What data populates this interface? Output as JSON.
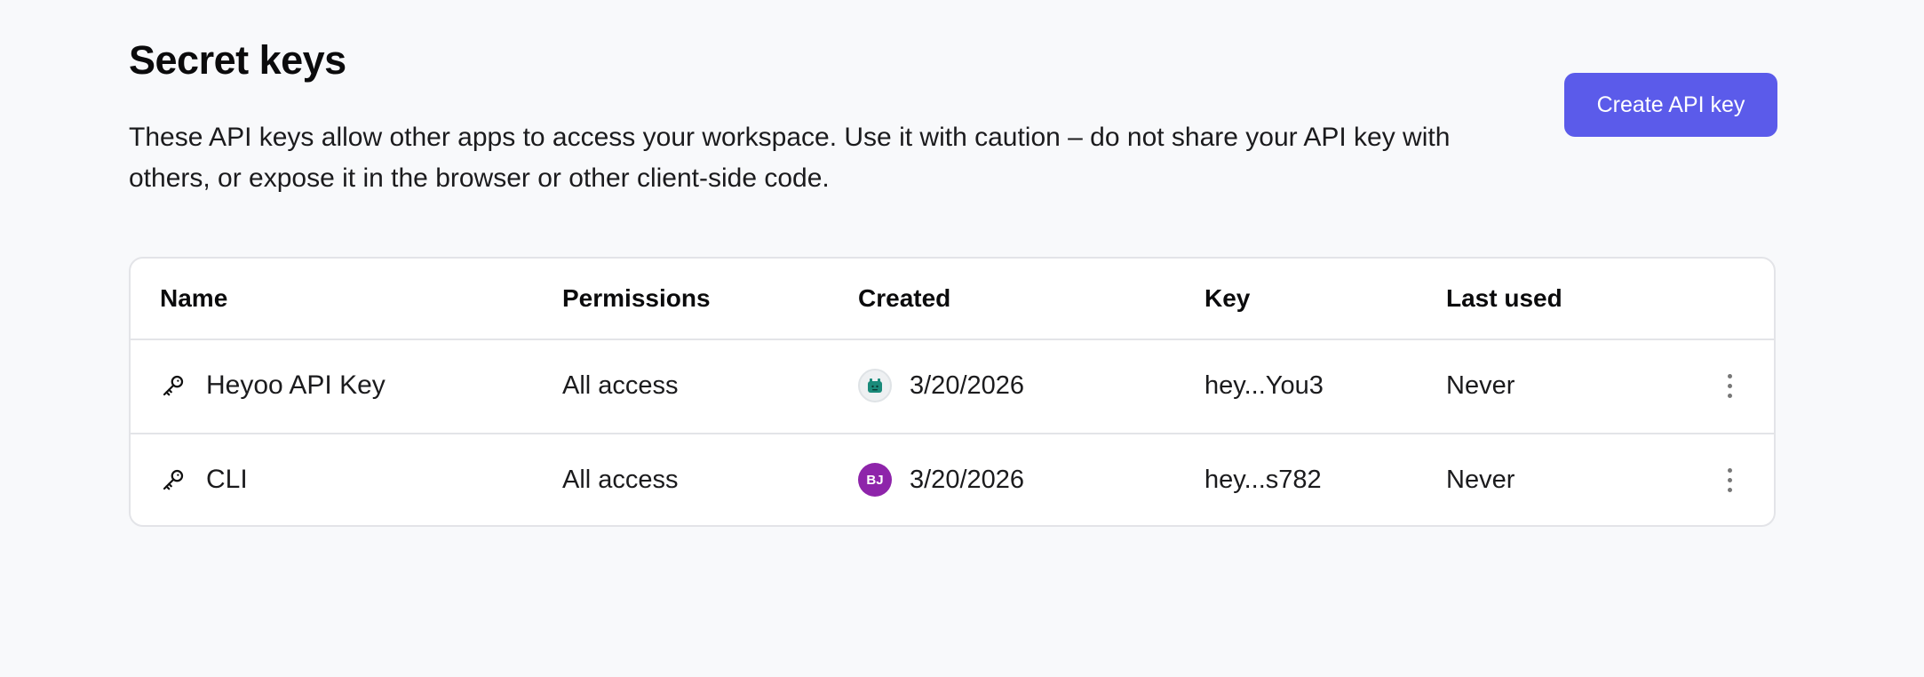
{
  "page": {
    "title": "Secret keys",
    "description": "These API keys allow other apps to access your workspace. Use it with caution – do not share your API key with others, or expose it in the browser or other client-side code.",
    "create_button_label": "Create API key"
  },
  "table": {
    "headers": {
      "name": "Name",
      "permissions": "Permissions",
      "created": "Created",
      "key": "Key",
      "last_used": "Last used"
    },
    "rows": [
      {
        "name": "Heyoo API Key",
        "permissions": "All access",
        "creator_avatar": "robot-avatar",
        "created": "3/20/2026",
        "key": "hey...You3",
        "last_used": "Never"
      },
      {
        "name": "CLI",
        "permissions": "All access",
        "creator_avatar": "initials-avatar",
        "creator_initials": "BJ",
        "created": "3/20/2026",
        "key": "hey...s782",
        "last_used": "Never"
      }
    ]
  },
  "colors": {
    "accent": "#5b5bea",
    "background": "#f8f9fb",
    "avatar_bj": "#8e24aa",
    "avatar_robot": "#1a8a7a"
  },
  "icons": {
    "row_icon": "key-icon",
    "row_menu": "more-vertical-icon"
  }
}
